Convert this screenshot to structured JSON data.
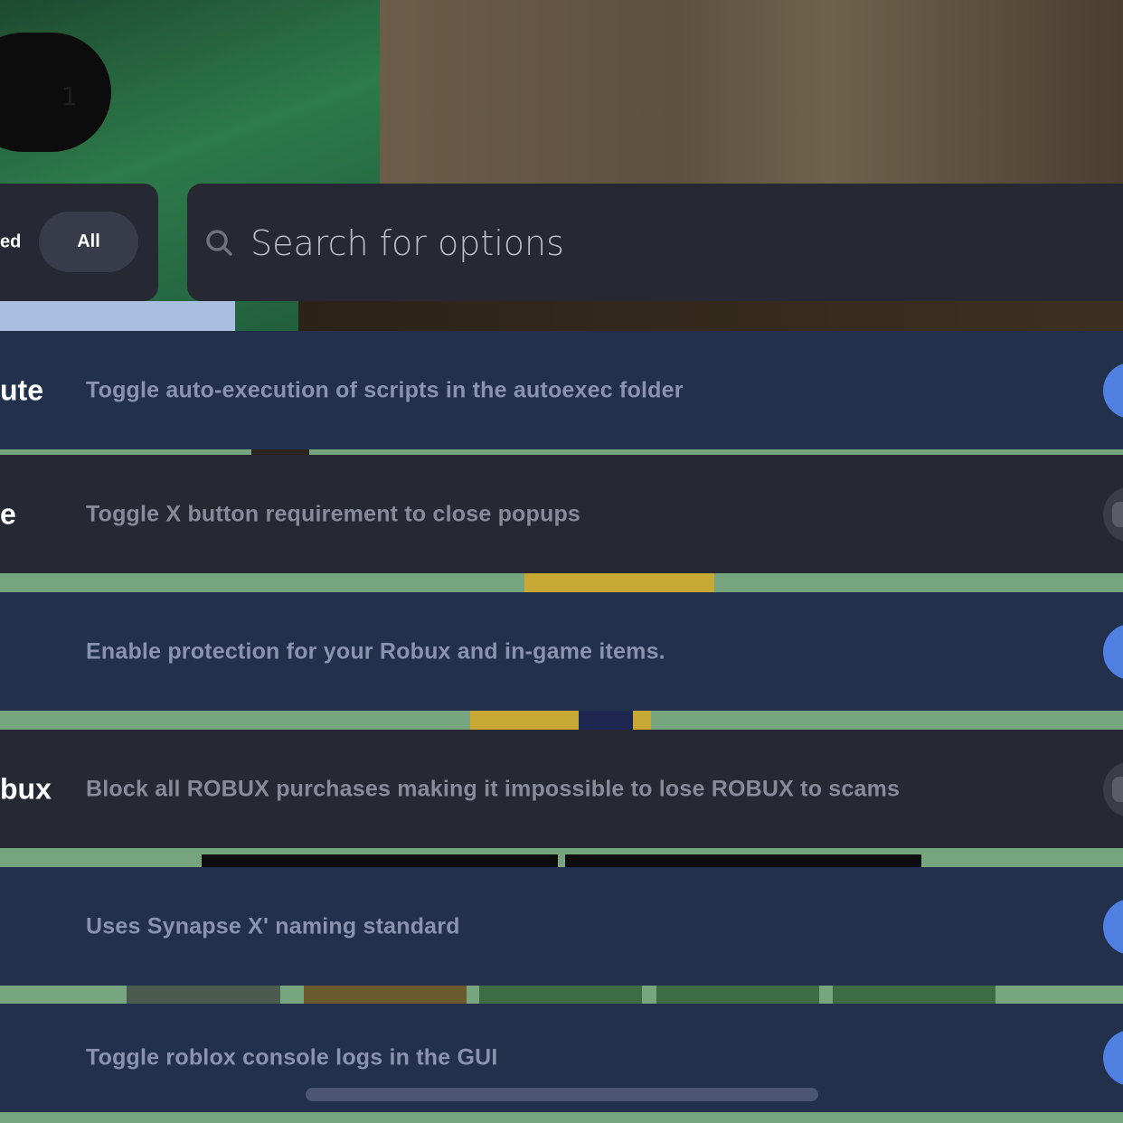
{
  "top_badge": {
    "digit": "1"
  },
  "filter": {
    "partial_label": "ed",
    "all_label": "All"
  },
  "search": {
    "placeholder": "Search for options"
  },
  "options": [
    {
      "name": "ute",
      "description": "Toggle auto-execution of scripts in the autoexec folder",
      "enabled": true
    },
    {
      "name": "e",
      "description": "Toggle X button requirement to close popups",
      "enabled": false
    },
    {
      "name": "",
      "description": "Enable protection for your Robux and in-game items.",
      "enabled": true
    },
    {
      "name": "bux",
      "description": "Block all ROBUX purchases making it impossible to lose ROBUX to scams",
      "enabled": false
    },
    {
      "name": "",
      "description": "Uses Synapse X' naming standard",
      "enabled": true
    },
    {
      "name": "",
      "description": "Toggle roblox console logs in the GUI",
      "enabled": true
    }
  ],
  "colors": {
    "row_enabled_bg": "#22304c",
    "row_disabled_bg": "#262834",
    "toggle_on": "#4f7fe0",
    "toggle_off": "#3a3d48"
  }
}
